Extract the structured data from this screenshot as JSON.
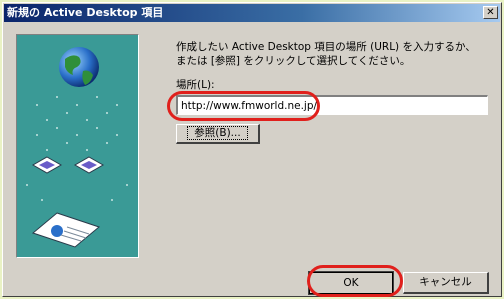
{
  "window": {
    "title": "新規の Active Desktop 項目",
    "close_label": "✕"
  },
  "instruction": {
    "line1": "作成したい Active Desktop 項目の場所 (URL) を入力するか、",
    "line2": "または [参照] をクリックして選択してください。"
  },
  "location": {
    "label": "場所(L):",
    "value": "http://www.fmworld.ne.jp/"
  },
  "buttons": {
    "browse": "参照(B)...",
    "ok": "OK",
    "cancel": "キャンセル"
  },
  "colors": {
    "title_bar": "#0a246a",
    "dialog_face": "#d4d0c8",
    "illustration_bg": "#3a9a96",
    "highlight": "#e0201c",
    "page_bg": "#e9f2c4"
  },
  "icons": [
    "globe-icon",
    "desktop-item-icon",
    "document-icon",
    "close-icon"
  ]
}
